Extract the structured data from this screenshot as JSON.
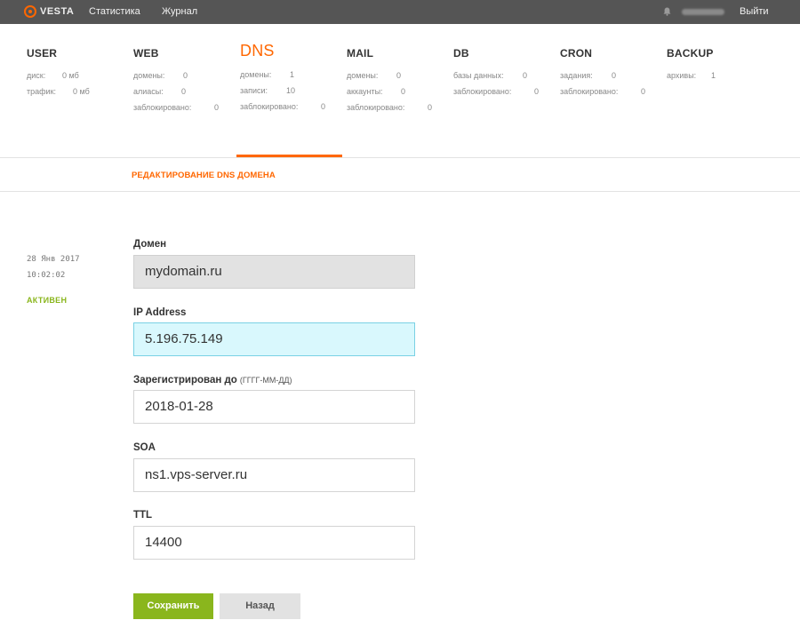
{
  "topbar": {
    "logo_text": "VESTA",
    "nav": [
      "Статистика",
      "Журнал"
    ],
    "logout_label": "Выйти"
  },
  "categories": [
    {
      "title": "USER",
      "rows": [
        {
          "k": "диск:",
          "v": "0 мб"
        },
        {
          "k": "трафик:",
          "v": "0 мб"
        }
      ]
    },
    {
      "title": "WEB",
      "rows": [
        {
          "k": "домены:",
          "v": "0"
        },
        {
          "k": "алиасы:",
          "v": "0"
        },
        {
          "k": "заблокировано:",
          "v": "0"
        }
      ]
    },
    {
      "title": "DNS",
      "rows": [
        {
          "k": "домены:",
          "v": "1"
        },
        {
          "k": "записи:",
          "v": "10"
        },
        {
          "k": "заблокировано:",
          "v": "0"
        }
      ]
    },
    {
      "title": "MAIL",
      "rows": [
        {
          "k": "домены:",
          "v": "0"
        },
        {
          "k": "аккаунты:",
          "v": "0"
        },
        {
          "k": "заблокировано:",
          "v": "0"
        }
      ]
    },
    {
      "title": "DB",
      "rows": [
        {
          "k": "базы данных:",
          "v": "0"
        },
        {
          "k": "заблокировано:",
          "v": "0"
        }
      ]
    },
    {
      "title": "CRON",
      "rows": [
        {
          "k": "задания:",
          "v": "0"
        },
        {
          "k": "заблокировано:",
          "v": "0"
        }
      ]
    },
    {
      "title": "BACKUP",
      "rows": [
        {
          "k": "архивы:",
          "v": "1"
        }
      ]
    }
  ],
  "active_category": "DNS",
  "section_title": "РЕДАКТИРОВАНИЕ DNS ДОМЕНА",
  "meta": {
    "date": "28 Янв 2017",
    "time": "10:02:02",
    "status": "АКТИВЕН"
  },
  "form": {
    "domain_label": "Домен",
    "domain_value": "mydomain.ru",
    "ip_label": "IP Address",
    "ip_value": "5.196.75.149",
    "exp_label": "Зарегистрирован до",
    "exp_hint": "(ГГГГ-ММ-ДД)",
    "exp_value": "2018-01-28",
    "soa_label": "SOA",
    "soa_value": "ns1.vps-server.ru",
    "ttl_label": "TTL",
    "ttl_value": "14400"
  },
  "buttons": {
    "save": "Сохранить",
    "back": "Назад"
  },
  "colors": {
    "accent": "#ff6701",
    "success": "#8ab61d",
    "topbar": "#555555",
    "focus_bg": "#d9f8fd"
  }
}
